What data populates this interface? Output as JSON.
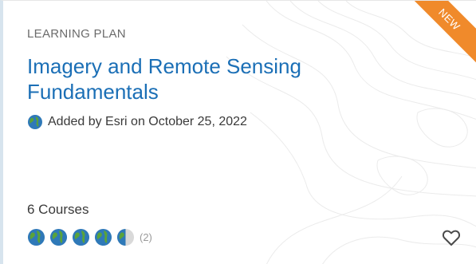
{
  "card": {
    "badge": "NEW",
    "eyebrow": "LEARNING PLAN",
    "title": "Imagery and Remote Sensing Fundamentals",
    "byline": "Added by Esri on October 25, 2022",
    "courses": "6 Courses",
    "rating": {
      "value": 4.5,
      "max": 5,
      "count_label": "(2)"
    },
    "icons": {
      "author": "globe-icon",
      "rating": "globe-rating-icon",
      "favorite": "heart-icon"
    }
  },
  "colors": {
    "title": "#1b6fb6",
    "badge": "#f08a2b",
    "text": "#3a3a3a",
    "muted": "#6b6b6b"
  }
}
